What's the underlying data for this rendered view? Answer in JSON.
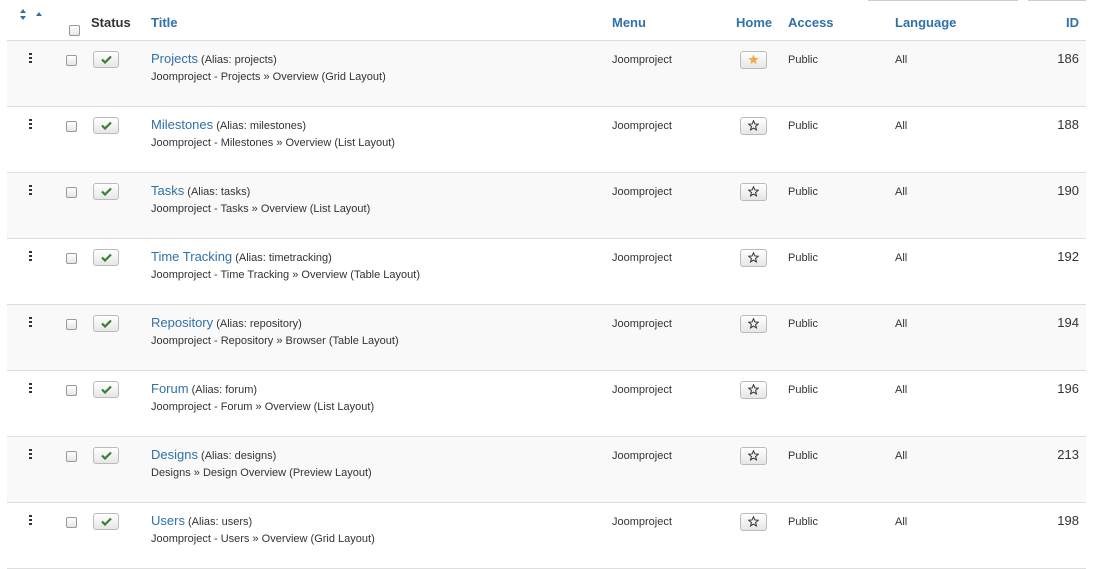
{
  "header": {
    "status": "Status",
    "title": "Title",
    "menu": "Menu",
    "home": "Home",
    "access": "Access",
    "language": "Language",
    "id": "ID"
  },
  "icons": {
    "sort": "sort-icon",
    "drag": "drag-handle-icon",
    "status": "check-icon",
    "home_default": "star-filled-icon",
    "home_other": "star-outline-icon"
  },
  "colors": {
    "link": "#3071a9",
    "check": "#378137",
    "star_filled": "#f0ad4e"
  },
  "rows": [
    {
      "title": "Projects",
      "alias": "(Alias: projects)",
      "path": "Joomproject - Projects » Overview (Grid Layout)",
      "menu": "Joomproject",
      "home": true,
      "access": "Public",
      "language": "All",
      "id": "186"
    },
    {
      "title": "Milestones",
      "alias": "(Alias: milestones)",
      "path": "Joomproject - Milestones » Overview (List Layout)",
      "menu": "Joomproject",
      "home": false,
      "access": "Public",
      "language": "All",
      "id": "188"
    },
    {
      "title": "Tasks",
      "alias": "(Alias: tasks)",
      "path": "Joomproject - Tasks » Overview (List Layout)",
      "menu": "Joomproject",
      "home": false,
      "access": "Public",
      "language": "All",
      "id": "190"
    },
    {
      "title": "Time Tracking",
      "alias": "(Alias: timetracking)",
      "path": "Joomproject - Time Tracking » Overview (Table Layout)",
      "menu": "Joomproject",
      "home": false,
      "access": "Public",
      "language": "All",
      "id": "192"
    },
    {
      "title": "Repository",
      "alias": "(Alias: repository)",
      "path": "Joomproject - Repository » Browser (Table Layout)",
      "menu": "Joomproject",
      "home": false,
      "access": "Public",
      "language": "All",
      "id": "194"
    },
    {
      "title": "Forum",
      "alias": "(Alias: forum)",
      "path": "Joomproject - Forum » Overview (List Layout)",
      "menu": "Joomproject",
      "home": false,
      "access": "Public",
      "language": "All",
      "id": "196"
    },
    {
      "title": "Designs",
      "alias": "(Alias: designs)",
      "path": "Designs » Design Overview (Preview Layout)",
      "menu": "Joomproject",
      "home": false,
      "access": "Public",
      "language": "All",
      "id": "213"
    },
    {
      "title": "Users",
      "alias": "(Alias: users)",
      "path": "Joomproject - Users » Overview (Grid Layout)",
      "menu": "Joomproject",
      "home": false,
      "access": "Public",
      "language": "All",
      "id": "198"
    }
  ]
}
